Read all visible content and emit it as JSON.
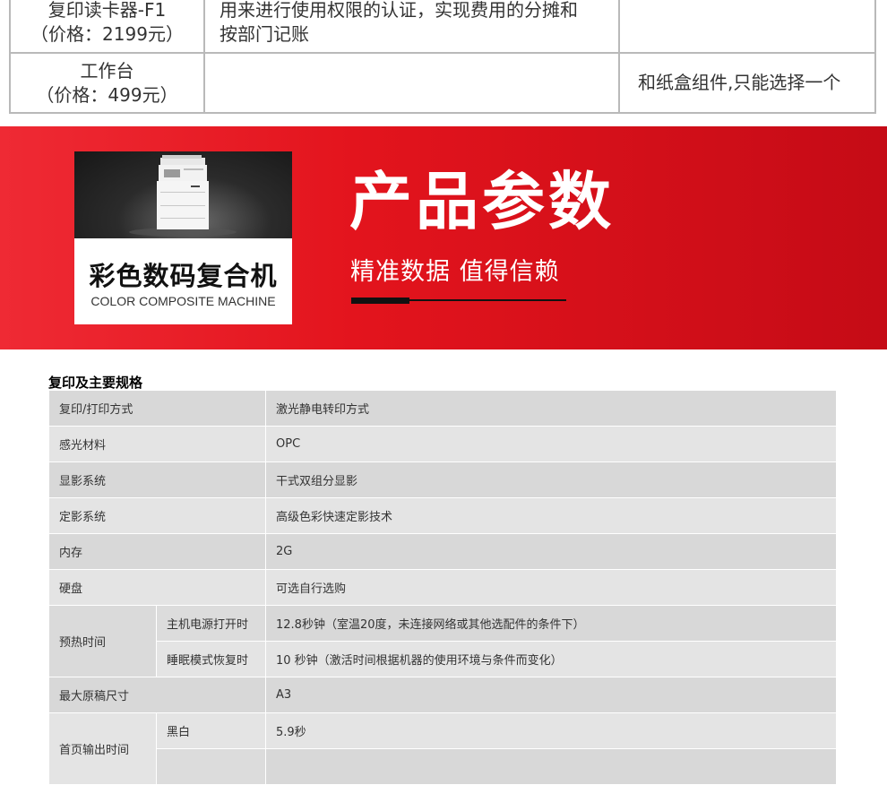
{
  "top_table": {
    "rows": [
      {
        "name_line1": "复印读卡器-F1",
        "name_line2": "（价格：2199元）",
        "desc_line1": "用来进行使用权限的认证，实现费用的分摊和",
        "desc_line2": "按部门记账",
        "note": ""
      },
      {
        "name_line1": "工作台",
        "name_line2": "（价格：499元）",
        "desc_line1": "",
        "desc_line2": "",
        "note": "和纸盒组件,只能选择一个"
      }
    ]
  },
  "banner": {
    "product_name_zh": "彩色数码复合机",
    "product_name_en": "COLOR COMPOSITE MACHINE",
    "title": "产品参数",
    "subtitle": "精准数据 值得信赖",
    "colors": {
      "gradient_start": "#ef2a34",
      "gradient_end": "#c50b16"
    }
  },
  "spec": {
    "title": "复印及主要规格",
    "rows": [
      {
        "label": "复印/打印方式",
        "value": "激光静电转印方式"
      },
      {
        "label": "感光材料",
        "value": "OPC"
      },
      {
        "label": "显影系统",
        "value": "干式双组分显影"
      },
      {
        "label": "定影系统",
        "value": "高级色彩快速定影技术"
      },
      {
        "label": "内存",
        "value": "2G"
      },
      {
        "label": "硬盘",
        "value": "可选自行选购"
      }
    ],
    "warmup": {
      "label": "预热时间",
      "items": [
        {
          "sub": "主机电源打开时",
          "value": "12.8秒钟（室温20度，未连接网络或其他选配件的条件下）"
        },
        {
          "sub": "睡眠模式恢复时",
          "value": "10 秒钟（激活时间根据机器的使用环境与条件而变化）"
        }
      ]
    },
    "max_size": {
      "label": "最大原稿尺寸",
      "value": "A3"
    },
    "first_copy": {
      "label": "首页输出时间",
      "items": [
        {
          "sub": "黑白",
          "value": "5.9秒"
        },
        {
          "sub": "",
          "value": ""
        }
      ]
    }
  }
}
